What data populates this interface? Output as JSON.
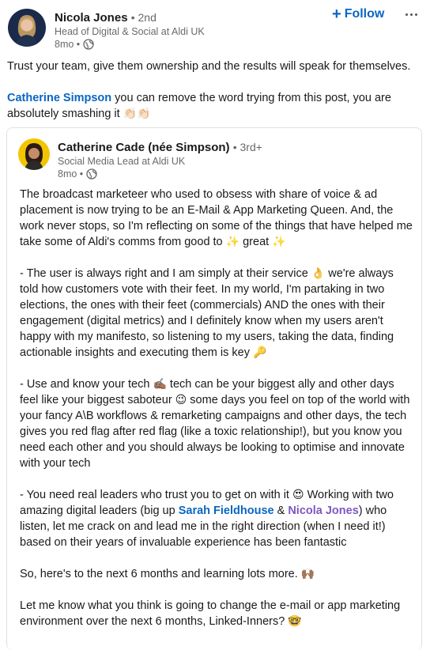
{
  "post": {
    "author": {
      "name": "Nicola Jones",
      "degree": "• 2nd",
      "headline": "Head of Digital & Social at Aldi UK",
      "time": "8mo •"
    },
    "follow_label": "Follow",
    "follow_icon": "plus-icon",
    "more_icon": "more-icon",
    "text": "Trust your team, give them ownership and the results will speak for themselves.",
    "mention_name": "Catherine Simpson",
    "mention_text": " you can remove the word trying from this post, you are absolutely smashing it ",
    "mention_emoji": "👏🏻👏🏻"
  },
  "shared": {
    "author": {
      "name": "Catherine Cade (née Simpson)",
      "degree": "• 3rd+",
      "headline": "Social Media Lead at Aldi UK",
      "time": "8mo •"
    },
    "p1_a": "The broadcast marketeer who used to obsess with share of voice & ad placement is now trying to be an E-Mail & App Marketing Queen. And, the work never stops, so I'm reflecting on some of the things that have helped me take some of Aldi's comms from good to ",
    "p1_b": "✨",
    "p1_c": " great ",
    "p1_d": "✨",
    "p2_a": "- The user is always right and I am simply at their service ",
    "p2_b": "👌",
    "p2_c": " we're always told how customers vote with their feet. In my world, I'm partaking in two elections, the ones with their feet (commercials) AND the ones with their engagement (digital metrics) and I definitely know when my users aren't happy with my manifesto, so listening to my users, taking the data, finding actionable insights and executing them is key ",
    "p2_d": "🔑",
    "p3_a": "- Use and know your tech ",
    "p3_b": "✍🏾",
    "p3_c": " tech can be your biggest ally and other days feel like your biggest saboteur ",
    "p3_d": "😉",
    "p3_e": " some days you feel on top of the world with your fancy A\\B workflows & remarketing campaigns and other days, the tech gives you red flag after red flag (like a toxic relationship!), but you know you need each other and you should always be looking to optimise and innovate with your tech",
    "p4_a": "- You need real leaders who trust you to get on with it ",
    "p4_b": "😍",
    "p4_c": " Working with two amazing digital leaders (big up ",
    "p4_link1": "Sarah Fieldhouse",
    "p4_amp": " & ",
    "p4_link2": "Nicola Jones",
    "p4_d": ") who listen, let me crack on and lead me in the right direction (when I need it!) based on their years of invaluable experience has been fantastic",
    "p5_a": "So, here's to the next 6 months and learning lots more. ",
    "p5_b": "🙌🏾",
    "p6_a": "Let me know what you think is going to change the e-mail or app marketing environment over the next 6 months, Linked-Inners? ",
    "p6_b": "🤓"
  },
  "colors": {
    "accent": "#0a66c2",
    "mention_purple": "#7e57c2"
  }
}
